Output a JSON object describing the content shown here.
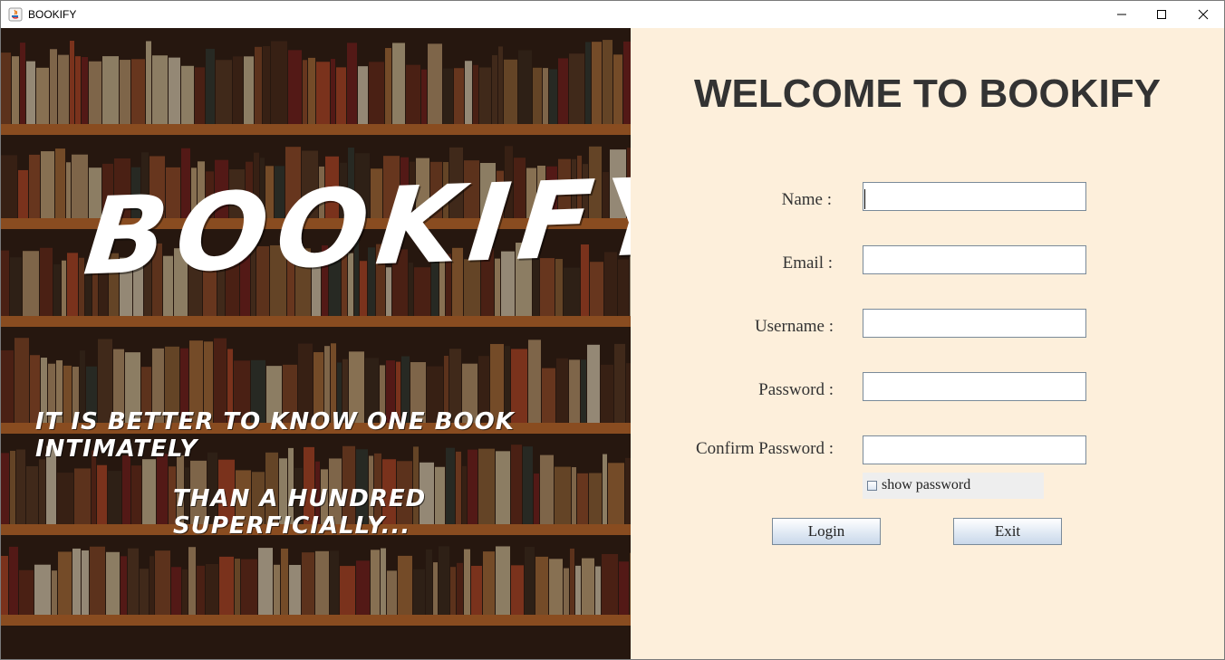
{
  "window": {
    "title": "BOOKIFY",
    "controls": [
      "minimize-icon",
      "maximize-icon",
      "close-icon"
    ]
  },
  "left": {
    "brand": "BOOKIFY",
    "quote_line1": "IT IS BETTER TO KNOW ONE BOOK INTIMATELY",
    "quote_line2": "THAN A HUNDRED SUPERFICIALLY..."
  },
  "form": {
    "heading": "WELCOME TO BOOKIFY",
    "name_label": "Name :",
    "email_label": "Email :",
    "username_label": "Username :",
    "password_label": "Password :",
    "confirm_label": "Confirm Password :",
    "name_value": "",
    "email_value": "",
    "username_value": "",
    "password_value": "",
    "confirm_value": "",
    "show_password_label": "show password",
    "show_password_checked": false,
    "login_label": "Login",
    "exit_label": "Exit"
  },
  "colors": {
    "form_bg": "#fdefdb",
    "heading": "#333333",
    "button_top": "#ffffff",
    "button_bottom": "#c9d8ea"
  }
}
